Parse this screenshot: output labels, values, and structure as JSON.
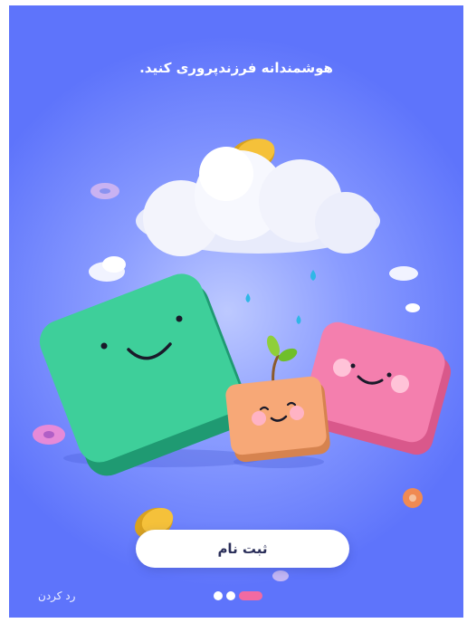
{
  "onboarding": {
    "title": "هوشمندانه فرزندپروری کنید.",
    "signup_label": "ثبت نام",
    "skip_label": "رد کردن",
    "pager": {
      "count": 3,
      "active_index": 2
    }
  },
  "colors": {
    "background": "#5e74fb",
    "button_text": "#2b2f5a",
    "pager_active": "#f26aa2",
    "green_cube": "#3ecf9a",
    "pink_cube": "#f47fae",
    "orange_cube": "#f7a877",
    "coin": "#f5c13a"
  },
  "icons": [
    "cloud-illustration",
    "green-cube-character",
    "pink-cube-character",
    "orange-cube-character",
    "sprout-icon",
    "coin-icon",
    "raindrop-icon",
    "donut-icon"
  ]
}
